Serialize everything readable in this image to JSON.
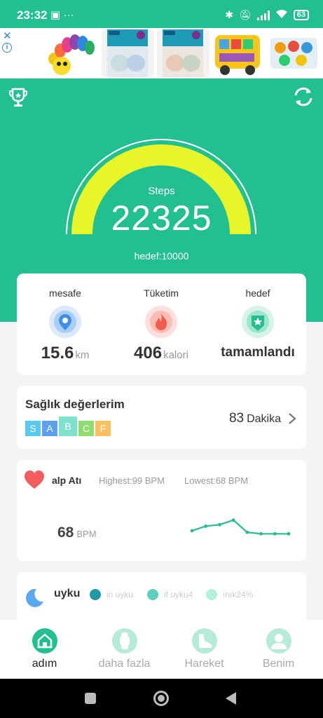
{
  "status_bar": {
    "time": "23:32",
    "left_icons": "▣ ···",
    "battery": "63"
  },
  "ad": {
    "close_label": "✕",
    "info_label": "i"
  },
  "hero": {
    "steps_label": "Steps",
    "steps_value": "22325",
    "goal_text": "hedef:10000",
    "progress_fraction": 1.0
  },
  "stats": {
    "distance": {
      "label": "mesafe",
      "value": "15.6",
      "unit": "km"
    },
    "consumption": {
      "label": "Tüketim",
      "value": "406",
      "unit": "kalori"
    },
    "goal": {
      "label": "hedef",
      "value": "tamamlandı"
    }
  },
  "health": {
    "title": "Sağlık değerlerim",
    "grades": [
      "S",
      "A",
      "B",
      "C",
      "F"
    ],
    "active_grade": "B",
    "minutes_value": "83",
    "minutes_unit": "Dakika"
  },
  "heart": {
    "title": "alp Atı",
    "highest": "Highest:99  BPM",
    "lowest": "Lowest:68  BPM",
    "current_value": "68",
    "current_unit": "BPM",
    "chart_values": [
      72,
      78,
      80,
      86,
      70,
      68,
      68,
      68
    ]
  },
  "sleep": {
    "title": "uyku",
    "legend": [
      "in uyku",
      "if uyku4",
      "ınık24%"
    ]
  },
  "bottom_nav": {
    "tabs": [
      {
        "label": "adım"
      },
      {
        "label": "daha fazla"
      },
      {
        "label": "Hareket"
      },
      {
        "label": "Benim"
      }
    ]
  },
  "colors": {
    "primary": "#22bf90",
    "gauge_fill": "#e8f52a",
    "gauge_border": "#ffffff"
  }
}
